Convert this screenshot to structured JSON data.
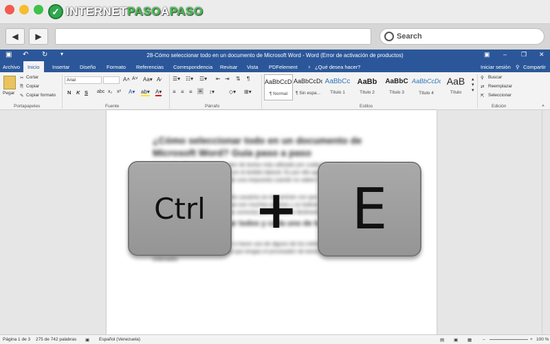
{
  "browser": {
    "logo": {
      "part1": "INTERNET",
      "part2": "PASO",
      "part3": "A",
      "part4": "PASO"
    },
    "search_placeholder": "Search",
    "back_icon": "back-arrow-icon",
    "forward_icon": "forward-arrow-icon"
  },
  "word": {
    "window_title": "28-Cómo seleccionar todo en un documento de Microsoft Word - Word (Error de activación de productos)",
    "tabs": [
      "Archivo",
      "Inicio",
      "Insertar",
      "Diseño",
      "Formato",
      "Referencias",
      "Correspondencia",
      "Revisar",
      "Vista",
      "PDFelement"
    ],
    "active_tab": "Inicio",
    "tell_me": "¿Qué desea hacer?",
    "signin": "Iniciar sesión",
    "share": "Compartir",
    "clipboard": {
      "paste": "Pegar",
      "cut": "Cortar",
      "copy": "Copiar",
      "format_painter": "Copiar formato",
      "label": "Portapapeles"
    },
    "font": {
      "name": "Arial",
      "size": "",
      "bold": "N",
      "italic": "K",
      "underline": "S",
      "label": "Fuente"
    },
    "paragraph": {
      "label": "Párrafo"
    },
    "styles": {
      "label": "Estilos",
      "items": [
        {
          "preview": "AaBbCcDc",
          "name": "¶ Normal"
        },
        {
          "preview": "AaBbCcDc",
          "name": "¶ Sin espa..."
        },
        {
          "preview": "AaBbCc",
          "name": "Título 1"
        },
        {
          "preview": "AaBb",
          "name": "Título 2"
        },
        {
          "preview": "AaBbC",
          "name": "Título 3"
        },
        {
          "preview": "AaBbCcDc",
          "name": "Título 4"
        },
        {
          "preview": "AaB",
          "name": "Título"
        }
      ]
    },
    "editing": {
      "find": "Buscar",
      "replace": "Reemplazar",
      "select": "Seleccionar",
      "label": "Edición"
    },
    "document": {
      "heading": "¿Cómo seleccionar todo en un documento de Microsoft Word? Guía paso a paso",
      "para1": "Hoy en día, Word es el procesador de textos más utilizado por cualquier persona, ya sea en un entorno personal, como también en el ámbito laboral. Es por ello que se encuentra bajo el ojo crítico de los usuarios que buscan una respuesta cuando no saben hacer uso de alguna función de esta aplicación.",
      "para2": "En estas circunstancias, diferentes usuarios se encuentran con que no pueden seleccionar todo de un documento de Word, ya que son muchas páginas y un tedioso trabajo. Por lo que, a continuación, explicamos los más correctos para realizarlo fácilmente.",
      "heading2": "Pasos para seleccionar todos y cada uno de los elementos de un documento de Word",
      "para3": "Por supuesto, antes de proceder a hacer uso de alguno de los métodos disponibles para llevar a cabo esta acción, es obviamente que tengas el procesador de textos de Microsoft instalado en tu ordenador."
    },
    "status": {
      "page": "Página 1 de 3",
      "words": "275 de 742 palabras",
      "lang": "Español (Venezuela)",
      "zoom": "100 %"
    }
  },
  "overlay": {
    "key1": "Ctrl",
    "plus": "+",
    "key2": "E"
  },
  "colors": {
    "word_blue": "#2b579a",
    "key_gray": "#a3a3a3",
    "logo_green": "#2fa84f"
  }
}
